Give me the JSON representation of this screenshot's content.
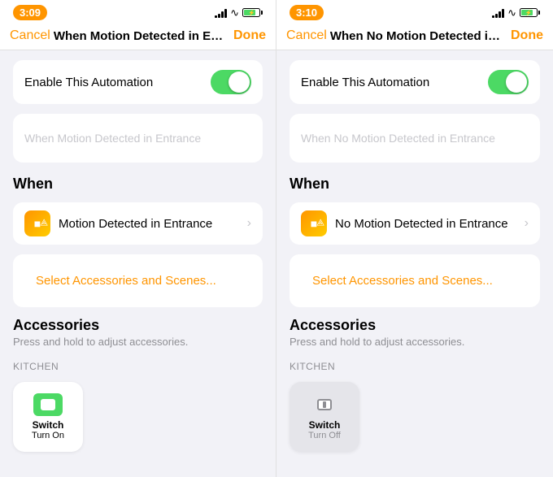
{
  "screens": [
    {
      "id": "left",
      "statusBar": {
        "time": "3:09",
        "timeStyle": "orange"
      },
      "nav": {
        "cancel": "Cancel",
        "title": "When Motion Detected in Entra...",
        "done": "Done"
      },
      "automation": {
        "toggleLabel": "Enable This Automation",
        "toggleOn": true,
        "descriptionPlaceholder": "When Motion Detected in Entrance",
        "whenHeader": "When",
        "motionLabel": "Motion Detected in Entrance",
        "selectLink": "Select Accessories and Scenes...",
        "accessoriesHeader": "Accessories",
        "accessoriesSubtitle": "Press and hold to adjust accessories.",
        "kitchenLabel": "KITCHEN",
        "device": {
          "name": "Switch",
          "state": "Turn On",
          "active": true
        }
      }
    },
    {
      "id": "right",
      "statusBar": {
        "time": "3:10",
        "timeStyle": "orange"
      },
      "nav": {
        "cancel": "Cancel",
        "title": "When No Motion Detected in E...",
        "done": "Done"
      },
      "automation": {
        "toggleLabel": "Enable This Automation",
        "toggleOn": true,
        "descriptionPlaceholder": "When No Motion Detected in Entrance",
        "whenHeader": "When",
        "motionLabel": "No Motion Detected in Entrance",
        "selectLink": "Select Accessories and Scenes...",
        "accessoriesHeader": "Accessories",
        "accessoriesSubtitle": "Press and hold to adjust accessories.",
        "kitchenLabel": "KITCHEN",
        "device": {
          "name": "Switch",
          "state": "Turn Off",
          "active": false
        }
      }
    }
  ],
  "icons": {
    "signal": "▌▌▌▌",
    "wifi": "wifi",
    "battery": "battery",
    "chevron": "›"
  }
}
